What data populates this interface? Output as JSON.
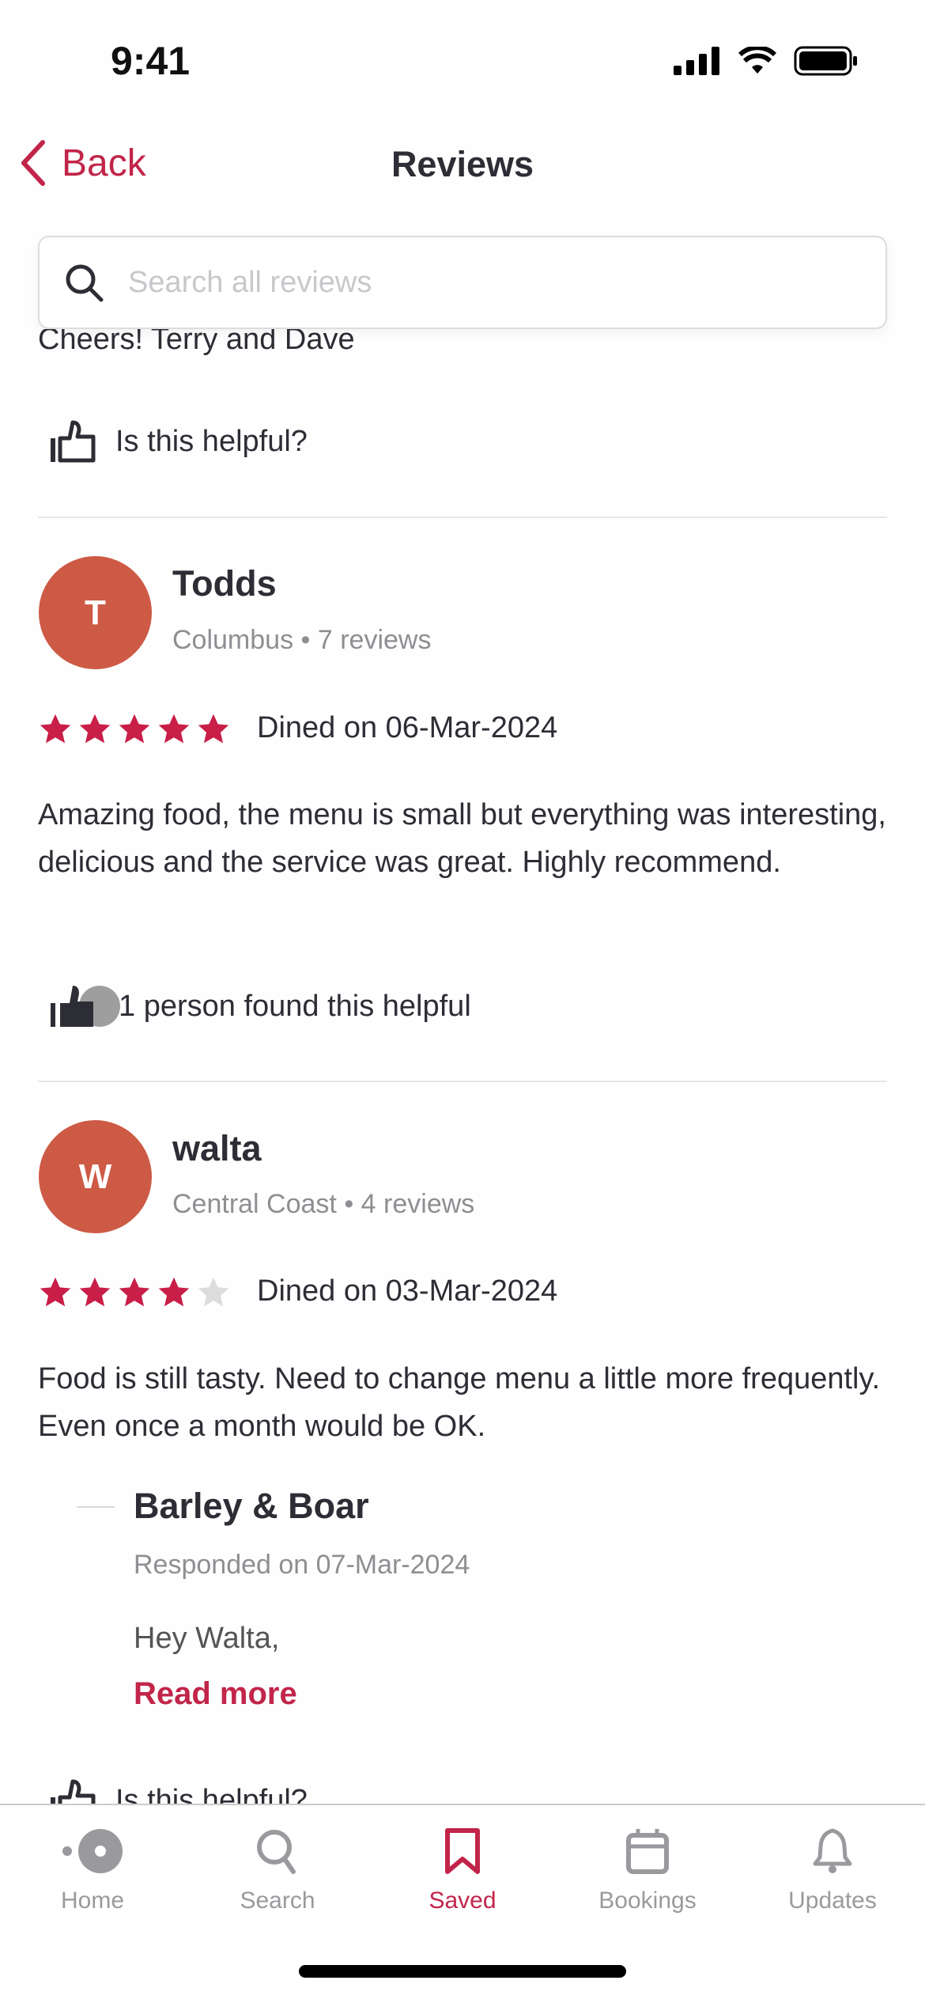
{
  "status_bar": {
    "time": "9:41"
  },
  "nav": {
    "back_label": "Back",
    "title": "Reviews"
  },
  "search": {
    "placeholder": "Search all reviews",
    "value": ""
  },
  "previous_review": {
    "text_tail": "Cheers! Terry and Dave",
    "helpful_label": "Is this helpful?"
  },
  "reviews": [
    {
      "initial": "T",
      "name": "Todds",
      "location": "Columbus",
      "review_count": "7 reviews",
      "rating": 5,
      "max_rating": 5,
      "dined": "Dined on 06-Mar-2024",
      "text": "Amazing food, the menu is small but everything was interesting, delicious and the service was great. Highly recommend.",
      "helpful_label": "1 person found this helpful"
    },
    {
      "initial": "W",
      "name": "walta",
      "location": "Central Coast",
      "review_count": "4 reviews",
      "rating": 4,
      "max_rating": 5,
      "dined": "Dined on 03-Mar-2024",
      "text": "Food is still tasty. Need to change menu a little more frequently. Even once a month would be OK.",
      "response": {
        "name": "Barley & Boar",
        "date": "Responded on 07-Mar-2024",
        "text": "Hey Walta,",
        "read_more": "Read more"
      },
      "helpful_label": "Is this helpful?"
    }
  ],
  "tabs": [
    {
      "label": "Home",
      "icon": "home-icon"
    },
    {
      "label": "Search",
      "icon": "search-icon"
    },
    {
      "label": "Saved",
      "icon": "bookmark-icon",
      "active": true
    },
    {
      "label": "Bookings",
      "icon": "calendar-icon"
    },
    {
      "label": "Updates",
      "icon": "bell-icon"
    }
  ],
  "colors": {
    "accent": "#c2254a",
    "avatar": "#cd5a45",
    "star_on": "#c81e48",
    "star_off": "#dcdcdc",
    "tab_inactive": "#9a9a9e"
  }
}
